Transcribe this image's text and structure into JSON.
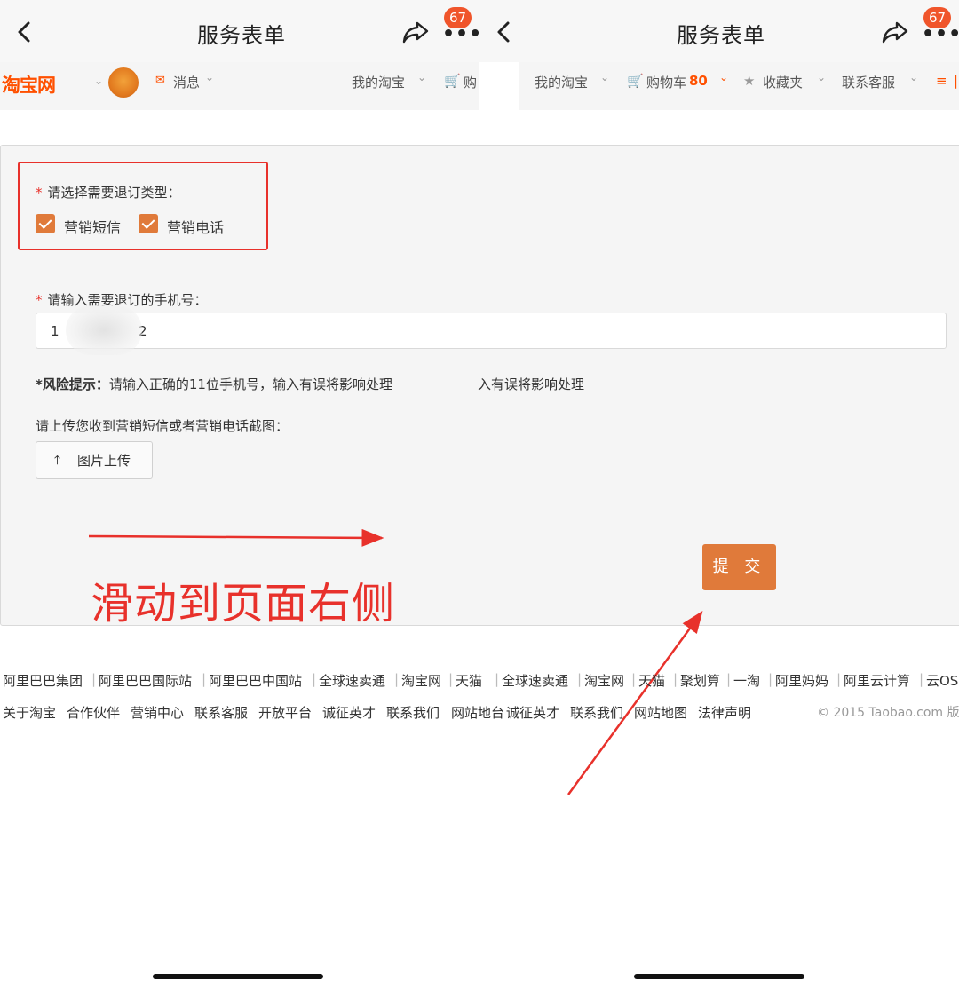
{
  "header": {
    "title": "服务表单",
    "notification_badge": "67"
  },
  "site_nav": {
    "logo": "淘宝网",
    "messages": "消息",
    "my_taobao": "我的淘宝",
    "cart_partial": "购",
    "cart": "购物车",
    "cart_count": "80",
    "favorites": "收藏夹",
    "customer_service": "联系客服"
  },
  "form": {
    "type_label": "请选择需要退订类型：",
    "option_sms": "营销短信",
    "option_call": "营销电话",
    "phone_label": "请输入需要退订的手机号：",
    "phone_value_start": "1",
    "phone_value_end": "2",
    "risk_title": "*风险提示：",
    "risk_text": "请输入正确的11位手机号，输入有误将影响处理",
    "risk_text_repeat": "入有误将影响处理",
    "upload_label": "请上传您收到营销短信或者营销电话截图：",
    "upload_button": "图片上传",
    "submit_button": "提 交"
  },
  "annotation": {
    "text": "滑动到页面右侧",
    "color": "#e8312b"
  },
  "footer": {
    "row1": [
      "阿里巴巴集团",
      "阿里巴巴国际站",
      "阿里巴巴中国站",
      "全球速卖通",
      "淘宝网",
      "天猫",
      "全球速卖通",
      "淘宝网",
      "天猫",
      "聚划算",
      "一淘",
      "阿里妈妈",
      "阿里云计算",
      "云OS"
    ],
    "row2": [
      "关于淘宝",
      "合作伙伴",
      "营销中心",
      "联系客服",
      "开放平台",
      "诚征英才",
      "联系我们",
      "网站地台",
      "诚征英才",
      "联系我们",
      "网站地图",
      "法律声明"
    ],
    "copyright": "© 2015 Taobao.com 版"
  },
  "colors": {
    "taobao_orange": "#ff5000",
    "button_orange": "#e07a3a",
    "badge_red": "#f0552b"
  }
}
